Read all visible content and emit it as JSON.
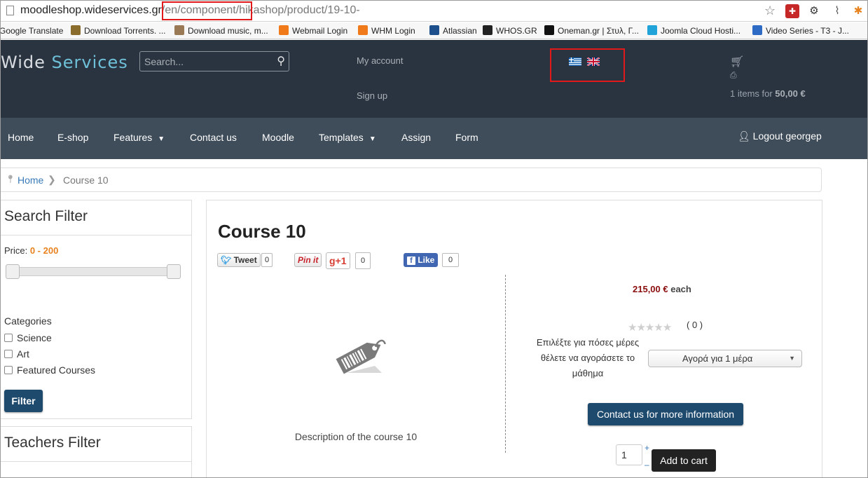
{
  "browser": {
    "url_host": "moodleshop.wideservices.gr",
    "url_sep": "/",
    "url_hl": "en/component/hik",
    "url_rest": "ashop/product/19-10-"
  },
  "bookmarks": [
    {
      "label": "Google Translate",
      "icon": "translate-icon",
      "color": "#4a7fd8"
    },
    {
      "label": "Download Torrents. ...",
      "icon": "torrent-icon",
      "color": "#8a6d2c"
    },
    {
      "label": "Download music, m...",
      "icon": "music-icon",
      "color": "#9a7a55"
    },
    {
      "label": "Webmail Login",
      "icon": "cpanel-icon",
      "color": "#f07a1a"
    },
    {
      "label": "WHM Login",
      "icon": "cpanel-icon",
      "color": "#f07a1a"
    },
    {
      "label": "Atlassian",
      "icon": "atlassian-icon",
      "color": "#1d4f8c"
    },
    {
      "label": "WHOS.GR",
      "icon": "w-icon",
      "color": "#222222"
    },
    {
      "label": "Oneman.gr | Στυλ, Γ...",
      "icon": "oneman-icon",
      "color": "#111111"
    },
    {
      "label": "Joomla Cloud Hosti...",
      "icon": "cloud-icon",
      "color": "#1fa3d8"
    },
    {
      "label": "Video Series - T3 - J...",
      "icon": "joomla-icon",
      "color": "#2d6bc5"
    }
  ],
  "header": {
    "logo_a": "Wide",
    "logo_b": " Services",
    "search_placeholder": "Search...",
    "my_account": "My account",
    "sign_up": "Sign up",
    "cart_prefix": "1 items for ",
    "cart_total": "50,00 €"
  },
  "nav": {
    "home": "Home",
    "eshop": "E-shop",
    "features": "Features",
    "contact": "Contact us",
    "moodle": "Moodle",
    "templates": "Templates",
    "assign": "Assign",
    "form": "Form",
    "logout": "Logout georgep"
  },
  "breadcrumb": {
    "home": "Home",
    "current": "Course 10"
  },
  "search_filter": {
    "title": "Search Filter",
    "price_label": "Price: ",
    "price_range": "0 - 200",
    "price_min": 0,
    "price_max": 200,
    "categories_label": "Categories",
    "categories": [
      "Science",
      "Art",
      "Featured Courses"
    ],
    "filter_button": "Filter"
  },
  "teachers_filter": {
    "title": "Teachers Filter"
  },
  "product": {
    "title": "Course 10",
    "tweet": "Tweet",
    "tweet_count": "0",
    "pin": "Pin it",
    "gplus": "g+1",
    "gplus_count": "0",
    "like": "Like",
    "like_count": "0",
    "description": "Description of the course 10",
    "price": "215,00 €",
    "price_unit": " each",
    "rating": 0,
    "votes": "( 0 )",
    "days_label": "Επιλέξτε για πόσες μέρες θέλετε να αγοράσετε το μάθημα",
    "days_selected": "Αγορά για 1 μέρα",
    "contact_button": "Contact us for more information",
    "quantity": "1",
    "add_to_cart": "Add to cart"
  }
}
